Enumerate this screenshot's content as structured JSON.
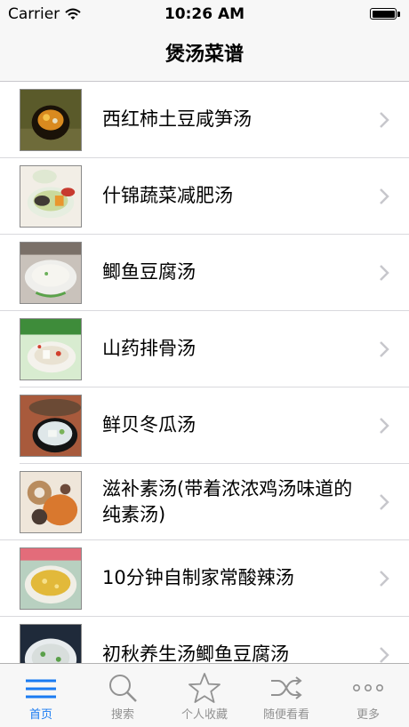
{
  "status_bar": {
    "carrier": "Carrier",
    "time": "10:26 AM"
  },
  "nav": {
    "title": "煲汤菜谱"
  },
  "recipes": [
    {
      "title": "西红柿土豆咸笋汤"
    },
    {
      "title": "什锦蔬菜减肥汤"
    },
    {
      "title": "鲫鱼豆腐汤"
    },
    {
      "title": "山药排骨汤"
    },
    {
      "title": "鲜贝冬瓜汤"
    },
    {
      "title": "滋补素汤(带着浓浓鸡汤味道的纯素汤)"
    },
    {
      "title": "10分钟自制家常酸辣汤"
    },
    {
      "title": "初秋养生汤鲫鱼豆腐汤"
    }
  ],
  "tab_bar": {
    "active_color": "#1a7bf2",
    "inactive_color": "#929292",
    "tabs": [
      {
        "label": "首页",
        "icon": "list-icon"
      },
      {
        "label": "搜索",
        "icon": "search-icon"
      },
      {
        "label": "个人收藏",
        "icon": "star-icon"
      },
      {
        "label": "随便看看",
        "icon": "shuffle-icon"
      },
      {
        "label": "更多",
        "icon": "more-icon"
      }
    ]
  }
}
